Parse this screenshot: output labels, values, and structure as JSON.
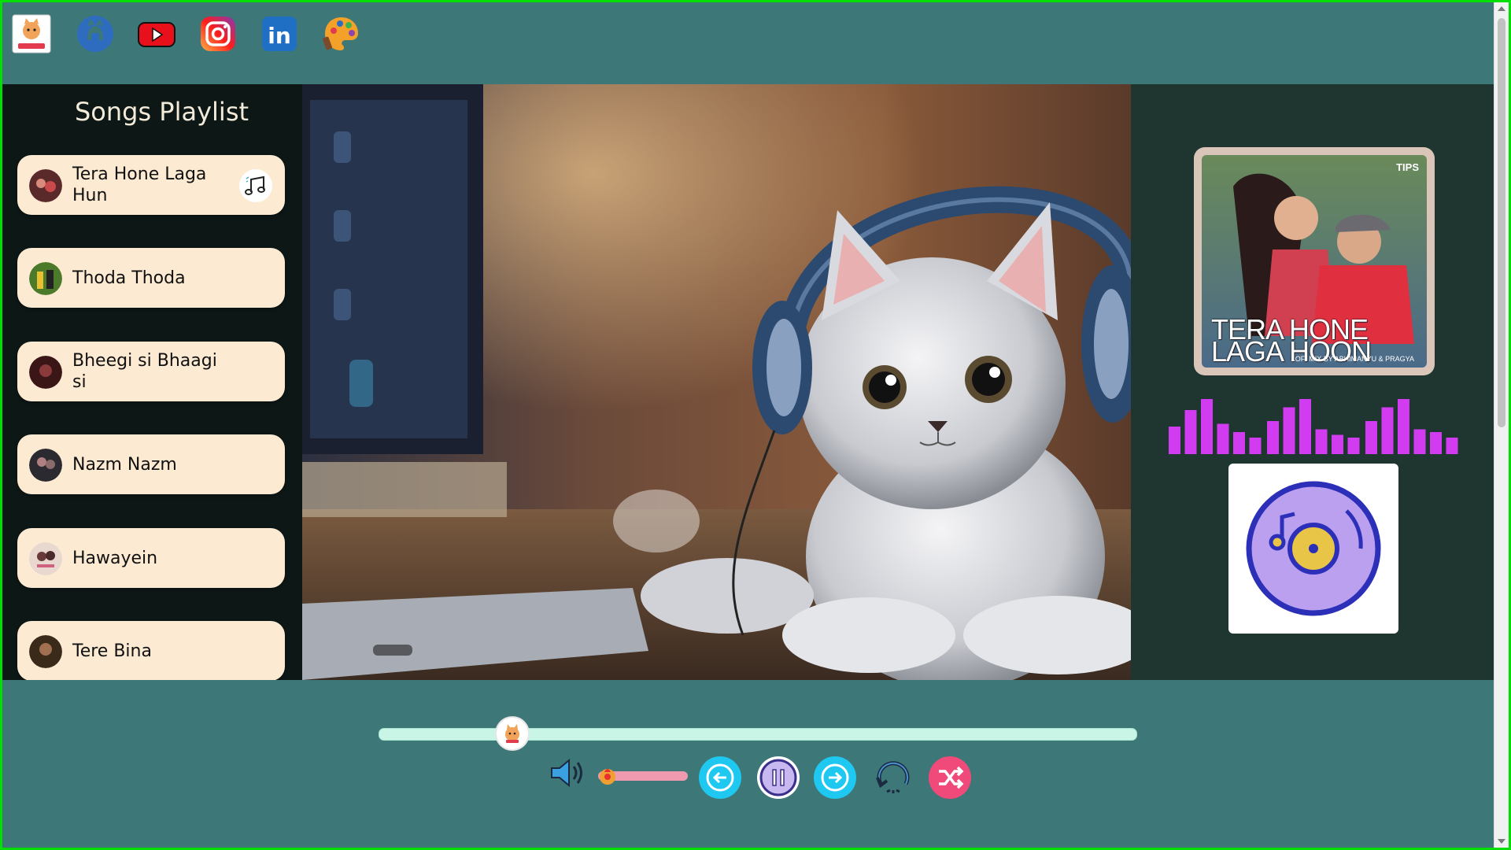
{
  "topbar": {
    "icons": [
      "kitten-logo-icon",
      "github-icon",
      "youtube-icon",
      "instagram-icon",
      "linkedin-icon",
      "palette-icon"
    ],
    "linkedin_text": "in"
  },
  "sidebar": {
    "title": "Songs Playlist",
    "songs": [
      {
        "label": "Tera Hone Laga Hun",
        "active": true
      },
      {
        "label": "Thoda Thoda",
        "active": false
      },
      {
        "label": "Bheegi si Bhaagi si",
        "active": false
      },
      {
        "label": "Nazm Nazm",
        "active": false
      },
      {
        "label": "Hawayein",
        "active": false
      },
      {
        "label": "Tere Bina",
        "active": false
      }
    ]
  },
  "now_playing": {
    "cover_line1": "TERA HONE",
    "cover_line2": "LAGA HOON",
    "cover_credit": "LOFI MIX BY ABHIMANYU & PRAGYA",
    "cover_logo": "TIPS",
    "eq_levels": [
      0.5,
      0.8,
      1.0,
      0.55,
      0.4,
      0.3,
      0.6,
      0.85,
      1.0,
      0.45,
      0.35,
      0.3,
      0.6,
      0.85,
      1.0,
      0.45,
      0.4,
      0.3
    ],
    "colors": {
      "eq": "#d13cf0",
      "disc_outer": "#3b3fd0",
      "disc_inner": "#e8c547"
    }
  },
  "player": {
    "progress": 0.176,
    "volume": 0.06,
    "buttons": [
      "volume-icon",
      "prev-button",
      "pause-button",
      "next-button",
      "repeat-button",
      "shuffle-button"
    ],
    "colors": {
      "prev": "#1ec8f0",
      "next": "#1ec8f0",
      "shuffle": "#f04a7a",
      "seek": "#c9f5e6",
      "volume": "#f09ab0"
    }
  }
}
